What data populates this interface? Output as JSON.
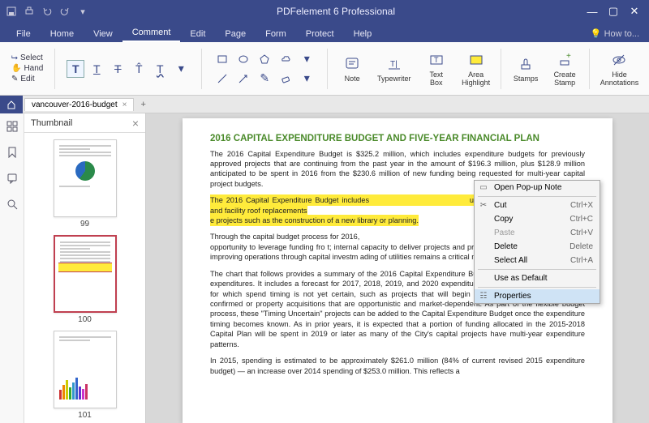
{
  "app": {
    "title": "PDFelement 6 Professional"
  },
  "menubar": {
    "items": [
      "File",
      "Home",
      "View",
      "Comment",
      "Edit",
      "Page",
      "Form",
      "Protect",
      "Help"
    ],
    "active_index": 3,
    "howto": "How to..."
  },
  "ribbon": {
    "select": "Select",
    "hand": "Hand",
    "edit": "Edit",
    "big": {
      "note": "Note",
      "typewriter": "Typewriter",
      "textbox": "Text Box",
      "area_highlight": "Area\nHighlight",
      "stamps": "Stamps",
      "create_stamp": "Create\nStamp",
      "hide_annotations": "Hide\nAnnotations"
    }
  },
  "tabs": {
    "current": "vancouver-2016-budget"
  },
  "sidepanel": {
    "title": "Thumbnail"
  },
  "thumbnails": [
    {
      "num": "99"
    },
    {
      "num": "100"
    },
    {
      "num": "101"
    }
  ],
  "document": {
    "heading": "2016 CAPITAL EXPENDITURE BUDGET AND FIVE-YEAR FINANCIAL PLAN",
    "p1": "The 2016 Capital Expenditure Budget is $325.2 million, which includes expenditure budgets for previously approved projects that are continuing from the past year in the amount of $196.3 million, plus $128.9 million anticipated to be spent in 2016 from the $230.6 million of new funding being requested for multi-year capital project budgets.",
    "hl_a": "The 2016 Capital Expenditure Budget includes ",
    "hl_b": "uch as sewer main reconstruction and facility roof replacements",
    "hl_c": "e projects such as the construction of a new library or planning",
    "hl_d": ".",
    "p3a": "Through the capital budget process for 2016,",
    "p3b": "prioritized based on need; the opportunity to leverage funding fro",
    "p3c": "t; internal capacity to deliver projects and programs; and the abi",
    "p3d": "formation by improving operations through capital investm",
    "p3e": "ading of utilities remains a critical mandate.",
    "p4": "The chart that follows provides a summary of the 2016 Capital Expenditure Budget compared to previous-year expenditures. It includes a forecast for 2017, 2018, 2019, and 2020 expenditures. It also includes expenditures for which spend timing is not yet certain, such as projects that will begin only when third-party funding is confirmed or property acquisitions that are opportunistic and market-dependent. As part of the flexible budget process, these \"Timing Uncertain\" projects can be added to the Capital Expenditure Budget once the expenditure timing becomes known. As in prior years, it is expected that a portion of funding allocated in the 2015-2018 Capital Plan will be spent in 2019 or later as many of the City's capital projects have multi-year expenditure patterns.",
    "p5": "In 2015, spending is estimated to be approximately $261.0 million (84% of current revised 2015 expenditure budget) — an increase over 2014 spending of $253.0 million. This reflects a"
  },
  "context_menu": {
    "items": [
      {
        "label": "Open Pop-up Note",
        "shortcut": ""
      },
      {
        "label": "Cut",
        "shortcut": "Ctrl+X",
        "icon": "✂"
      },
      {
        "label": "Copy",
        "shortcut": "Ctrl+C"
      },
      {
        "label": "Paste",
        "shortcut": "Ctrl+V",
        "disabled": true
      },
      {
        "label": "Delete",
        "shortcut": "Delete"
      },
      {
        "label": "Select All",
        "shortcut": "Ctrl+A"
      },
      {
        "label": "Use as Default",
        "shortcut": ""
      },
      {
        "label": "Properties",
        "shortcut": "",
        "selected": true
      }
    ]
  }
}
